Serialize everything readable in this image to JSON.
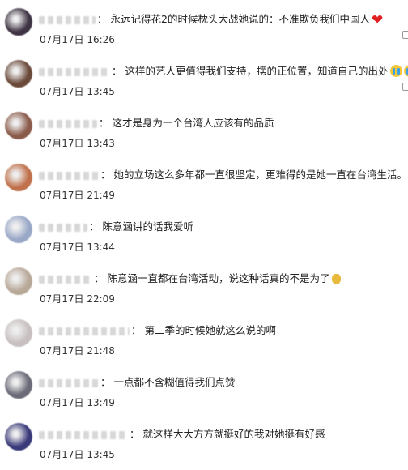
{
  "comments": [
    {
      "username": "",
      "text": "永远记得花2的时候枕头大战她说的：不准欺负我们中国人",
      "time": "07月17日 16:26",
      "emoji": "heart",
      "avatar": "#3e3444"
    },
    {
      "username": "",
      "text": "这样的艺人更值得我们支持，摆的正位置，知道自己的出处",
      "time": "07月17日 13:45",
      "emoji": "cry-cry",
      "avatar": "#6b4a3a"
    },
    {
      "username": "",
      "text": "这才是身为一个台湾人应该有的品质",
      "time": "07月17日 13:43",
      "emoji": "",
      "avatar": "#8a5a4a"
    },
    {
      "username": "",
      "text": "她的立场这么多年都一直很坚定，更难得的是她一直在台湾生活。",
      "time": "07月17日 21:49",
      "emoji": "",
      "avatar": "#c0704a"
    },
    {
      "username": "",
      "text": "陈意涵讲的话我爱听",
      "time": "07月17日 13:44",
      "emoji": "",
      "avatar": "#9aa8c8"
    },
    {
      "username": "",
      "text": "陈意涵一直都在台湾活动，说这种话真的不是为了",
      "time": "07月17日 22:09",
      "emoji": "bag",
      "avatar": "#b8a898"
    },
    {
      "username": "",
      "text": "第二季的时候她就这么说的啊",
      "time": "07月17日 21:48",
      "emoji": "",
      "avatar": "#c8c0c0"
    },
    {
      "username": "",
      "text": "一点都不含糊值得我们点赞",
      "time": "07月17日 13:49",
      "emoji": "",
      "avatar": "#6a6a78"
    },
    {
      "username": "",
      "text": "就这样大大方方就挺好的我对她挺有好感",
      "time": "07月17日 13:45",
      "emoji": "",
      "avatar": "#3a3a7a"
    }
  ],
  "colors": {
    "heart": "#e02020",
    "text": "#222222",
    "time": "#333333"
  }
}
